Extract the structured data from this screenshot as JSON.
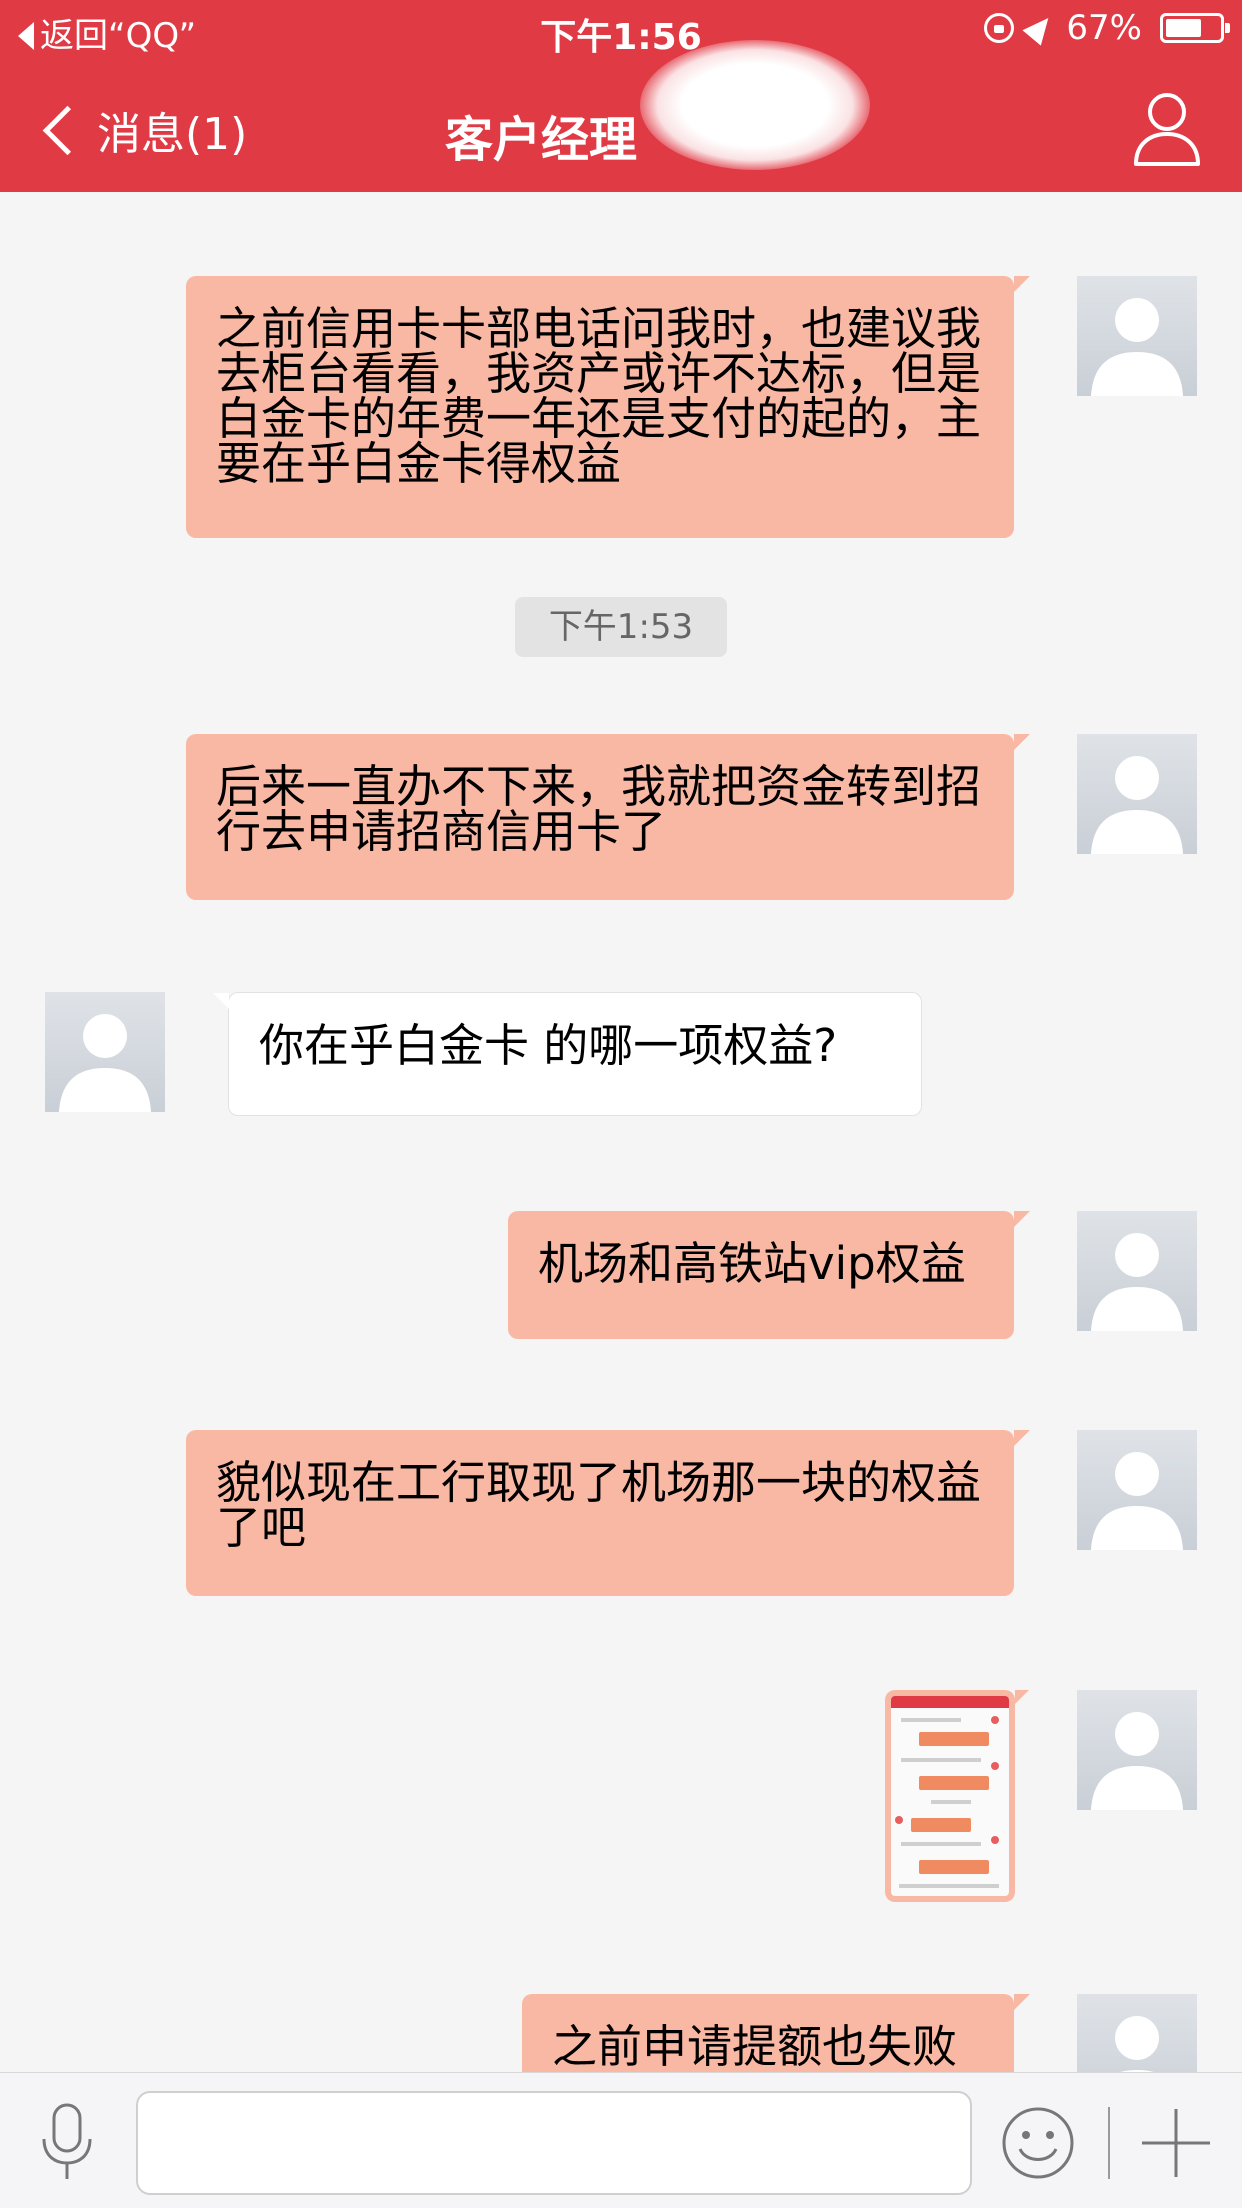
{
  "status_bar": {
    "back_label": "返回“QQ”",
    "time": "下午1:56",
    "battery": "67%",
    "battery_level": 0.67
  },
  "nav": {
    "back_label": "消息(1)",
    "title": "客户经理"
  },
  "messages": [
    {
      "side": "out",
      "text": "之前信用卡卡部电话问我时，也建议我去柜台看看，我资产或许不达标，但是白金卡的年费一年还是支付的起的，主要在乎白金卡得权益"
    },
    {
      "side": "out",
      "text": "后来一直办不下来，我就把资金转到招行去申请招商信用卡了"
    },
    {
      "side": "in",
      "text": "你在乎白金卡 的哪一项权益?"
    },
    {
      "side": "out",
      "text": "机场和高铁站vip权益"
    },
    {
      "side": "out",
      "text": "貌似现在工行取现了机场那一块的权益了吧"
    },
    {
      "side": "out",
      "type": "image"
    },
    {
      "side": "out",
      "text": "之前申请提额也失败"
    }
  ],
  "timestamp": "下午1:53",
  "input": {
    "placeholder": ""
  },
  "colors": {
    "header": "#e03a45",
    "outgoing_bubble": "#f9b8a3",
    "incoming_bubble": "#ffffff",
    "background": "#f5f5f5"
  },
  "icons": {
    "status_back": "triangle-left-icon",
    "nav_back": "chevron-left-icon",
    "profile": "person-outline-icon",
    "avatar": "default-person-avatar",
    "mic": "microphone-icon",
    "emoji": "smiley-icon",
    "plus": "plus-icon"
  }
}
